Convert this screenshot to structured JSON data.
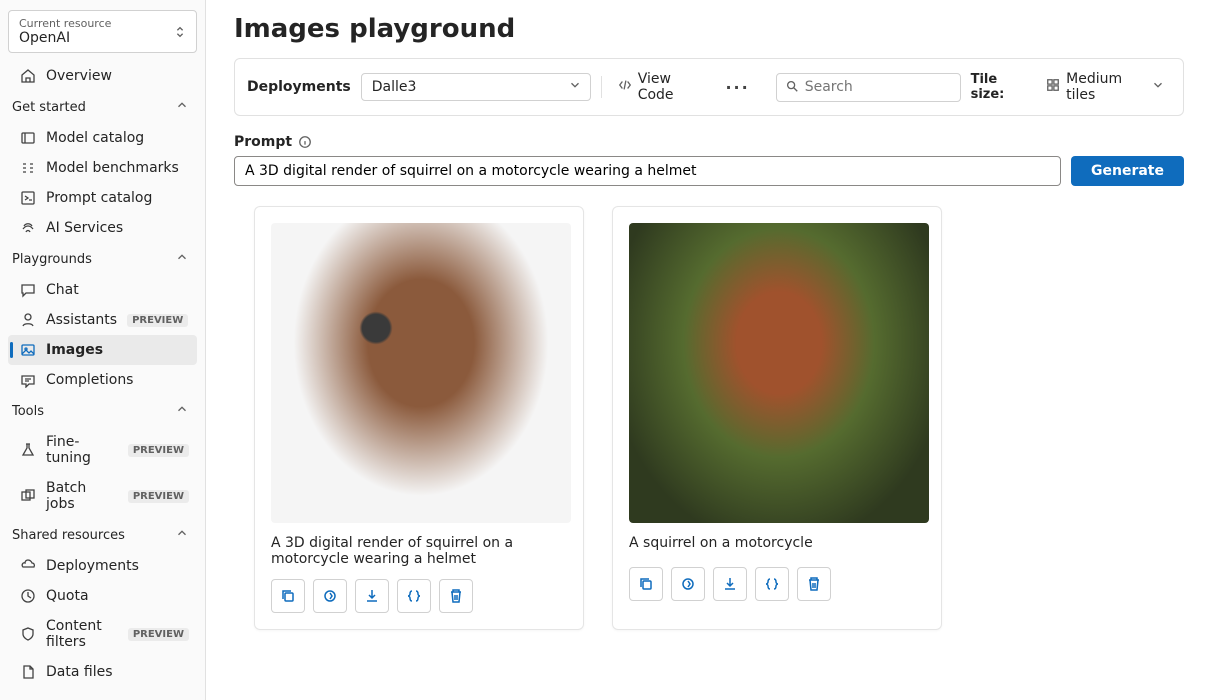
{
  "resource": {
    "label": "Current resource",
    "value": "OpenAI"
  },
  "sidebar": {
    "overview": "Overview",
    "sections": {
      "getStarted": {
        "title": "Get started",
        "items": [
          "Model catalog",
          "Model benchmarks",
          "Prompt catalog",
          "AI Services"
        ]
      },
      "playgrounds": {
        "title": "Playgrounds",
        "items": [
          "Chat",
          "Assistants",
          "Images",
          "Completions"
        ],
        "assistantsBadge": "PREVIEW"
      },
      "tools": {
        "title": "Tools",
        "items": [
          "Fine-tuning",
          "Batch jobs"
        ],
        "fineTuningBadge": "PREVIEW",
        "batchBadge": "PREVIEW"
      },
      "shared": {
        "title": "Shared resources",
        "items": [
          "Deployments",
          "Quota",
          "Content filters",
          "Data files"
        ],
        "filtersBadge": "PREVIEW"
      }
    }
  },
  "page": {
    "title": "Images playground",
    "deploymentsLabel": "Deployments",
    "deploymentValue": "Dalle3",
    "viewCode": "View Code",
    "searchPlaceholder": "Search",
    "tileSizeLabel": "Tile size:",
    "tileSizeValue": "Medium tiles",
    "promptLabel": "Prompt",
    "promptValue": "A 3D digital render of squirrel on a motorcycle wearing a helmet",
    "generateLabel": "Generate"
  },
  "results": [
    {
      "caption": "A 3D digital render of squirrel on a motorcycle wearing a helmet",
      "imgClass": "a"
    },
    {
      "caption": "A squirrel on a motorcycle",
      "imgClass": "b"
    }
  ]
}
